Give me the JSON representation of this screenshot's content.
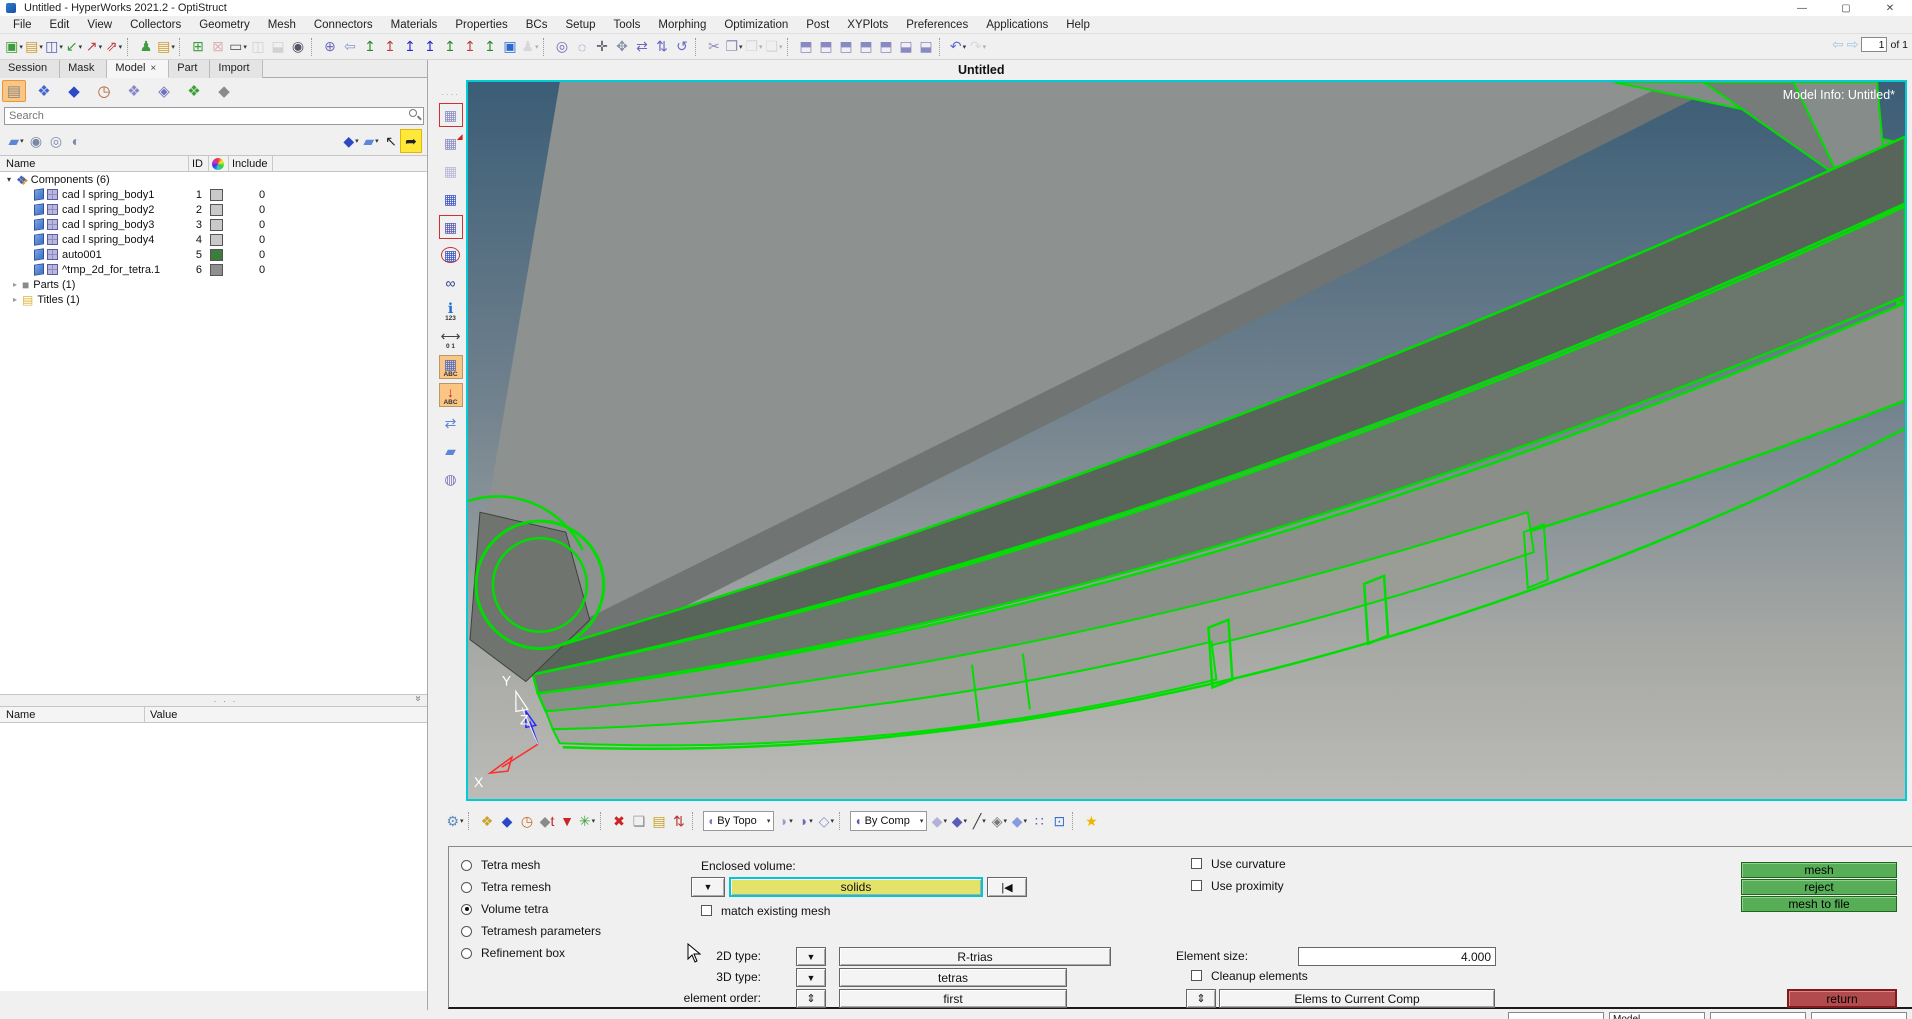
{
  "window": {
    "title": "Untitled - HyperWorks 2021.2 - OptiStruct",
    "chrome": {
      "minimize": "—",
      "maximize": "▢",
      "close": "✕"
    }
  },
  "menu": {
    "items": [
      "File",
      "Edit",
      "View",
      "Collectors",
      "Geometry",
      "Mesh",
      "Connectors",
      "Materials",
      "Properties",
      "BCs",
      "Setup",
      "Tools",
      "Morphing",
      "Optimization",
      "Post",
      "XYPlots",
      "Preferences",
      "Applications",
      "Help"
    ]
  },
  "toolbar": {
    "page_value": "1",
    "page_of": "of 1",
    "prev_arrow": "⇦",
    "next_arrow": "⇨",
    "groups": [
      [
        {
          "n": "new-session-icon",
          "g": "▣",
          "c": "#3d9c3d",
          "cr": 1
        },
        {
          "n": "open-model-icon",
          "g": "▤",
          "c": "#cf9c2c",
          "cr": 1
        },
        {
          "n": "save-model-icon",
          "g": "◫",
          "c": "#4f5cb8",
          "cr": 1
        },
        {
          "n": "import-model-icon",
          "g": "↙",
          "c": "#3d9c3d",
          "cr": 1
        },
        {
          "n": "export-model-icon",
          "g": "↗",
          "c": "#c23c3c",
          "cr": 1
        },
        {
          "n": "export-deck-icon",
          "g": "⇗",
          "c": "#c23c3c",
          "cr": 1
        }
      ],
      [
        {
          "n": "user-profile-icon",
          "g": "♟",
          "c": "#3d9c3d"
        },
        {
          "n": "load-results-icon",
          "g": "▤",
          "c": "#cf9c2c",
          "cr": 1
        }
      ],
      [
        {
          "n": "add-page-icon",
          "g": "⊞",
          "c": "#3d9c3d"
        },
        {
          "n": "delete-page-icon",
          "g": "⊠",
          "c": "#c23c3c",
          "ds": 1
        },
        {
          "n": "page-layout-icon",
          "g": "▭",
          "c": "#555",
          "cr": 1
        },
        {
          "n": "expand-window-icon",
          "g": "◫",
          "c": "#999",
          "ds": 1
        },
        {
          "n": "swap-window-icon",
          "g": "⬓",
          "c": "#999",
          "ds": 1
        },
        {
          "n": "window-find-icon",
          "g": "◉",
          "c": "#556"
        }
      ],
      [
        {
          "n": "fit-view-icon",
          "g": "⊕",
          "c": "#6a6ac0"
        },
        {
          "n": "previous-view-icon",
          "g": "⇦",
          "c": "#8a96d4"
        },
        {
          "n": "view-xy-top-icon",
          "g": "↥",
          "c": "#2a8a2a"
        },
        {
          "n": "view-xy-bottom-icon",
          "g": "↥",
          "c": "#c23c3c"
        },
        {
          "n": "view-xz-left-icon",
          "g": "↥",
          "c": "#2a2ad0"
        },
        {
          "n": "view-xz-right-icon",
          "g": "↥",
          "c": "#2a2ad0"
        },
        {
          "n": "view-yz-front-icon",
          "g": "↥",
          "c": "#2a8a2a"
        },
        {
          "n": "view-yz-rear-icon",
          "g": "↥",
          "c": "#c23c3c"
        },
        {
          "n": "view-iso-icon",
          "g": "↥",
          "c": "#2a8a2a"
        },
        {
          "n": "display-options-icon",
          "g": "▣",
          "c": "#2a6ad0"
        },
        {
          "n": "user-view-icon",
          "g": "♟",
          "c": "#aaa",
          "ds": 1,
          "cr": 1
        }
      ],
      [
        {
          "n": "zoom-out-icon",
          "g": "◎",
          "c": "#6a6ab8"
        },
        {
          "n": "zoom-lasso-icon",
          "g": "◌",
          "c": "#6a6ab8"
        },
        {
          "n": "translate-view-icon",
          "g": "✛",
          "c": "#556"
        },
        {
          "n": "pan-hand-icon",
          "g": "✥",
          "c": "#8890a8"
        },
        {
          "n": "arc-rotate-icon",
          "g": "⇄",
          "c": "#6a6ac0"
        },
        {
          "n": "vertical-rotate-icon",
          "g": "⇅",
          "c": "#6a6ac0"
        },
        {
          "n": "spin-view-icon",
          "g": "↺",
          "c": "#6a6ac0"
        }
      ],
      [
        {
          "n": "cut-icon",
          "g": "✂",
          "c": "#8a8ab8"
        },
        {
          "n": "copy-icon",
          "g": "❐",
          "c": "#8a8ab8",
          "cr": 1
        },
        {
          "n": "paste-icon",
          "g": "❒",
          "c": "#aaa",
          "ds": 1,
          "cr": 1
        },
        {
          "n": "paste-special-icon",
          "g": "❑",
          "c": "#aaa",
          "ds": 1,
          "cr": 1
        }
      ],
      [
        {
          "n": "capture-screen-icon",
          "g": "⬒",
          "c": "#8a8ac2"
        },
        {
          "n": "capture-window-icon",
          "g": "⬒",
          "c": "#8a8ac2"
        },
        {
          "n": "capture-area-icon",
          "g": "⬒",
          "c": "#8a8ac2"
        },
        {
          "n": "capture-selection-icon",
          "g": "⬒",
          "c": "#8a8ac2"
        },
        {
          "n": "capture-clipboard-icon",
          "g": "⬒",
          "c": "#8a8ac2"
        },
        {
          "n": "record-video-icon",
          "g": "⬓",
          "c": "#8a8ac2"
        },
        {
          "n": "record-area-icon",
          "g": "⬓",
          "c": "#8a8ac2"
        }
      ],
      [
        {
          "n": "undo-icon",
          "g": "↶",
          "c": "#5a6ad0",
          "cr": 1
        },
        {
          "n": "redo-icon",
          "g": "↷",
          "c": "#aab",
          "ds": 1,
          "cr": 1
        }
      ]
    ]
  },
  "tabs": {
    "items": [
      {
        "label": "Session"
      },
      {
        "label": "Mask"
      },
      {
        "label": "Model",
        "active": true,
        "close": "×"
      },
      {
        "label": "Part"
      },
      {
        "label": "Import"
      }
    ]
  },
  "browser": {
    "icons1": [
      {
        "n": "model-folder-icon",
        "g": "▤",
        "c": "#8a8a8a",
        "active": 1
      },
      {
        "n": "entity-network-icon",
        "g": "❖",
        "c": "#4466cc"
      },
      {
        "n": "solid-entity-icon",
        "g": "◆",
        "c": "#2a48c8"
      },
      {
        "n": "folder-history-icon",
        "g": "◷",
        "c": "#b06030"
      },
      {
        "n": "folder-mesh-icon",
        "g": "❖",
        "c": "#8888c8"
      },
      {
        "n": "folder-wire-icon",
        "g": "◈",
        "c": "#7070c0"
      },
      {
        "n": "folder-components-icon",
        "g": "❖",
        "c": "#3aa13a"
      },
      {
        "n": "folder-import-icon",
        "g": "◆",
        "c": "#8a8a8a"
      }
    ],
    "search_placeholder": "Search",
    "icons2_left": [
      {
        "n": "component-display-icon",
        "g": "▰",
        "c": "#5b87d6",
        "cr": 1
      },
      {
        "n": "show-all-icon",
        "g": "◉",
        "c": "#7a88a8"
      },
      {
        "n": "show-none-icon",
        "g": "◎",
        "c": "#7a88a8"
      },
      {
        "n": "reverse-show-icon",
        "g": "◐",
        "c": "#7a88a8"
      }
    ],
    "icons2_right": [
      {
        "n": "geometry-style-icon",
        "g": "◆",
        "c": "#2a48c8",
        "cr": 1
      },
      {
        "n": "element-style-icon",
        "g": "▰",
        "c": "#5b87d6",
        "cr": 1
      },
      {
        "n": "selector-arrow-icon",
        "g": "↖",
        "c": "#222"
      },
      {
        "n": "isolate-highlight-icon",
        "g": "➦",
        "c": "#222",
        "hl": 1
      }
    ],
    "columns": {
      "name": "Name",
      "id": "ID",
      "include": "Include"
    },
    "tree": [
      {
        "t": "root",
        "label": "Components (6)"
      },
      {
        "t": "comp",
        "label": "cad l spring_body1",
        "id": "1",
        "sw": "#c9c9c9",
        "inc": "0"
      },
      {
        "t": "comp",
        "label": "cad l spring_body2",
        "id": "2",
        "sw": "#c9c9c9",
        "inc": "0"
      },
      {
        "t": "comp",
        "label": "cad l spring_body3",
        "id": "3",
        "sw": "#c9c9c9",
        "inc": "0"
      },
      {
        "t": "comp",
        "label": "cad l spring_body4",
        "id": "4",
        "sw": "#c9c9c9",
        "inc": "0"
      },
      {
        "t": "comp",
        "label": "auto001",
        "id": "5",
        "sw": "#3c7d3c",
        "inc": "0"
      },
      {
        "t": "comp",
        "label": "^tmp_2d_for_tetra.1",
        "id": "6",
        "sw": "#8f8f8f",
        "inc": "0"
      },
      {
        "t": "grp",
        "label": "Parts (1)",
        "icon": "cube",
        "ic": "#8a8a8a",
        "g": "■"
      },
      {
        "t": "grp",
        "label": "Titles (1)",
        "icon": "doc",
        "ic": "#e0b23c",
        "g": "▤"
      }
    ],
    "prop_columns": {
      "name": "Name",
      "value": "Value"
    },
    "splitter_dots": "· · ·",
    "splitter_chevron": "»"
  },
  "viewport": {
    "title": "Untitled",
    "model_info": "Model Info: Untitled*",
    "axis": {
      "x": "X",
      "y": "Y",
      "z": "Z"
    },
    "colors": {
      "border": "#00ccd6",
      "highlight_green": "#00dd00",
      "solid_gray": "#8d9190",
      "bg_top": "#3b5d76",
      "bg_bottom": "#bbbbb7"
    }
  },
  "vstrip": [
    {
      "n": "element-display-box-icon",
      "g": "▦",
      "c": "#8c8cc4",
      "frame": 1
    },
    {
      "n": "element-export-icon",
      "g": "▦",
      "c": "#8c8cc4",
      "sub": "◢",
      "subc": "#cc2222"
    },
    {
      "n": "element-wireframe-icon",
      "g": "▦",
      "c": "#b8b8d8"
    },
    {
      "n": "element-shaded-icon",
      "g": "▦",
      "c": "#3a55c0"
    },
    {
      "n": "element-select-box-icon",
      "g": "▦",
      "c": "#5a5ab0",
      "frame": 1
    },
    {
      "n": "element-select-circle-icon",
      "g": "▦",
      "c": "#3a55c0",
      "ring": 1
    },
    {
      "n": "binoculars-icon",
      "g": "∞",
      "c": "#2a3f8f"
    },
    {
      "n": "numbers-info-icon",
      "g": "ℹ",
      "c": "#1a6fd4",
      "cap": "123"
    },
    {
      "n": "measure-scale-icon",
      "g": "⟷",
      "c": "#444",
      "cap": "0  1"
    },
    {
      "n": "label-abc-icon",
      "g": "▦",
      "c": "#4a6ad0",
      "cap": "ABC",
      "active": 1
    },
    {
      "n": "label-arrow-icon",
      "g": "↓",
      "c": "#cc2222",
      "cap": "ABC",
      "active": 1
    },
    {
      "n": "mesh-transform-icon",
      "g": "⇄",
      "c": "#5b87d6"
    },
    {
      "n": "surface-edit-icon",
      "g": "▰",
      "c": "#5b87d6"
    },
    {
      "n": "solid-bottle-icon",
      "g": "◍",
      "c": "#7a7ac0"
    }
  ],
  "view_toolbar": {
    "left": [
      {
        "n": "quick-settings-icon",
        "g": "⚙",
        "c": "#5a8ab8",
        "cr": 1
      },
      {
        "sep": 1
      },
      {
        "n": "create-component-icon",
        "g": "❖",
        "c": "#c9a227"
      },
      {
        "n": "create-solid-icon",
        "g": "◆",
        "c": "#2a48c8"
      },
      {
        "n": "geometry-history-icon",
        "g": "◷",
        "c": "#c06a2a"
      },
      {
        "n": "geometry-tag-icon",
        "g": "◆",
        "c": "#8a8a8a",
        "sub": "t",
        "subc": "#cc2222"
      },
      {
        "n": "import-down-icon",
        "g": "▼",
        "c": "#cc2222"
      },
      {
        "n": "organize-icon",
        "g": "✳",
        "c": "#3aa13a",
        "cr": 1
      },
      {
        "sep": 1
      },
      {
        "n": "delete-entity-icon",
        "g": "✖",
        "c": "#cc2222"
      },
      {
        "n": "layers-icon",
        "g": "❏",
        "c": "#888"
      },
      {
        "n": "folder-update-icon",
        "g": "▤",
        "c": "#c9a227"
      },
      {
        "n": "renumber-icon",
        "g": "⇅",
        "c": "#bb3333"
      },
      {
        "sep": 1
      }
    ],
    "by_topo": {
      "label": "By Topo",
      "icon_color": "#7a7ac0"
    },
    "mid": [
      {
        "n": "surface-shade-icon",
        "g": "◗",
        "c": "#9a9ad0",
        "cr": 1
      },
      {
        "n": "surface-shade-edges-icon",
        "g": "◗",
        "c": "#6a6ac0",
        "cr": 1
      },
      {
        "n": "solid-shade-icon",
        "g": "◇",
        "c": "#8a8ad0",
        "cr": 1
      },
      {
        "sep": 1
      }
    ],
    "by_comp": {
      "label": "By Comp",
      "icon_color": "#5a5ab8"
    },
    "right": [
      {
        "n": "mesh-style-icon",
        "g": "◆",
        "c": "#b0b0d8",
        "cr": 1
      },
      {
        "n": "element-color-icon",
        "g": "◆",
        "c": "#5a5ab8",
        "cr": 1
      },
      {
        "n": "feature-line-icon",
        "g": "╱",
        "c": "#444",
        "cr": 1
      },
      {
        "n": "mesh-quality-icon",
        "g": "◈",
        "c": "#777",
        "cr": 1
      },
      {
        "n": "plate-thickness-icon",
        "g": "◆",
        "c": "#8899e0",
        "cr": 1
      },
      {
        "n": "multi-cubes-icon",
        "g": "∷",
        "c": "#5a5ab8"
      },
      {
        "n": "performance-monitor-icon",
        "g": "⊡",
        "c": "#3a6fd0"
      },
      {
        "sep": 1
      },
      {
        "n": "favorites-star-icon",
        "g": "★",
        "c": "#f0b400"
      }
    ]
  },
  "panel": {
    "radios": [
      {
        "label": "Tetra mesh"
      },
      {
        "label": "Tetra remesh"
      },
      {
        "label": "Volume tetra",
        "selected": true
      },
      {
        "label": "Tetramesh parameters"
      },
      {
        "label": "Refinement box"
      }
    ],
    "enclosed_volume_label": "Enclosed volume:",
    "entity_dropdown_glyph": "▼",
    "solids_button": "solids",
    "reset_glyph": "|◀",
    "match_existing_mesh": "match existing mesh",
    "type2d_label": "2D type:",
    "type2d_value": "R-trias",
    "type3d_label": "3D type:",
    "type3d_value": "tetras",
    "order_label": "element order:",
    "order_value": "first",
    "switch_glyph": "⇕",
    "use_curvature": "Use curvature",
    "use_proximity": "Use proximity",
    "element_size_label": "Element size:",
    "element_size_value": "4.000",
    "cleanup_elements": "Cleanup elements",
    "elems_dest_value": "Elems to Current Comp",
    "mesh_button": "mesh",
    "reject_button": "reject",
    "mesh_to_file_button": "mesh to file",
    "return_button": "return",
    "colors": {
      "action_green": "#57ae57",
      "return_red": "#b24b4d",
      "solids_yellow": "#e3e36a"
    }
  },
  "statusbar": {
    "fields": [
      "",
      "Model",
      "",
      ""
    ]
  }
}
